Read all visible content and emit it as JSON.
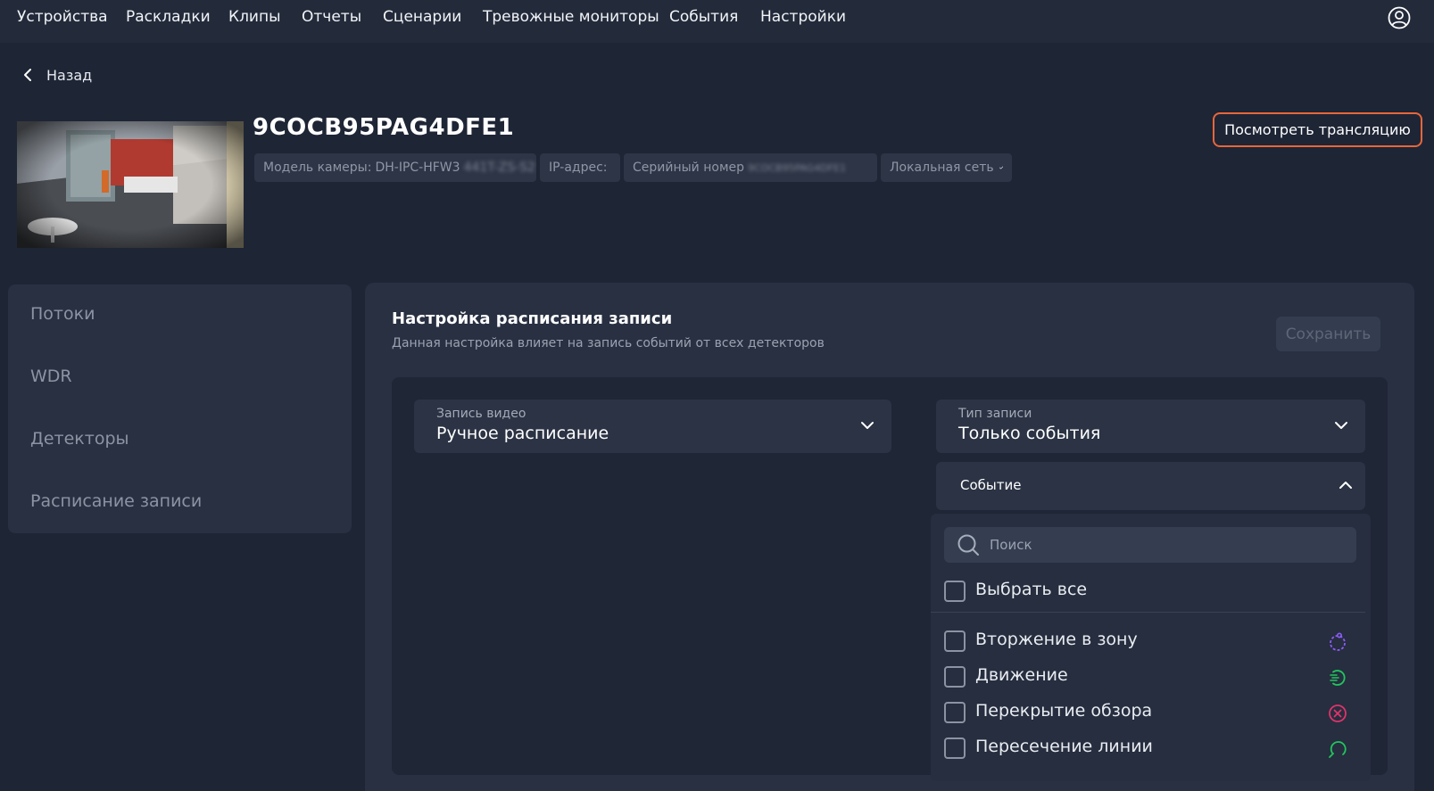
{
  "nav": {
    "items": [
      "Устройства",
      "Раскладки",
      "Клипы",
      "Отчеты",
      "Сценарии",
      "Тревожные мониторы",
      "События",
      "Настройки"
    ]
  },
  "back_label": "Назад",
  "camera": {
    "title": "9COCB95PAG4DFE1",
    "model_label": "Модель камеры:",
    "model_value": "DH-IPC-HFW3",
    "model_hidden": "441T-ZS-S2",
    "ip_label": "IP-адрес:",
    "serial_label": "Серийный номер",
    "serial_hidden": "9COCB95PAG4DFE1",
    "network_label": "Локальная сеть",
    "watch_button": "Посмотреть трансляцию"
  },
  "sidebar": {
    "items": [
      "Потоки",
      "WDR",
      "Детекторы",
      "Расписание записи"
    ]
  },
  "schedule": {
    "title": "Настройка расписания записи",
    "subtitle": "Данная настройка влияет на запись событий от всех детекторов",
    "save_label": "Сохранить",
    "video_record": {
      "label": "Запись видео",
      "value": "Ручное расписание"
    },
    "record_type": {
      "label": "Тип записи",
      "value": "Только события"
    },
    "event": {
      "label": "Событие",
      "search_placeholder": "Поиск",
      "select_all": "Выбрать все",
      "options": [
        {
          "label": "Вторжение в зону",
          "icon": "intrusion-icon",
          "color": "#8b5cf6"
        },
        {
          "label": "Движение",
          "icon": "motion-icon",
          "color": "#22c55e"
        },
        {
          "label": "Перекрытие обзора",
          "icon": "tamper-icon",
          "color": "#e0336b"
        },
        {
          "label": "Пересечение линии",
          "icon": "line-crossing-icon",
          "color": "#22c55e"
        }
      ]
    }
  },
  "colors": {
    "accent_orange": "#e8663a",
    "background": "#1e2535",
    "panel": "#283042"
  }
}
